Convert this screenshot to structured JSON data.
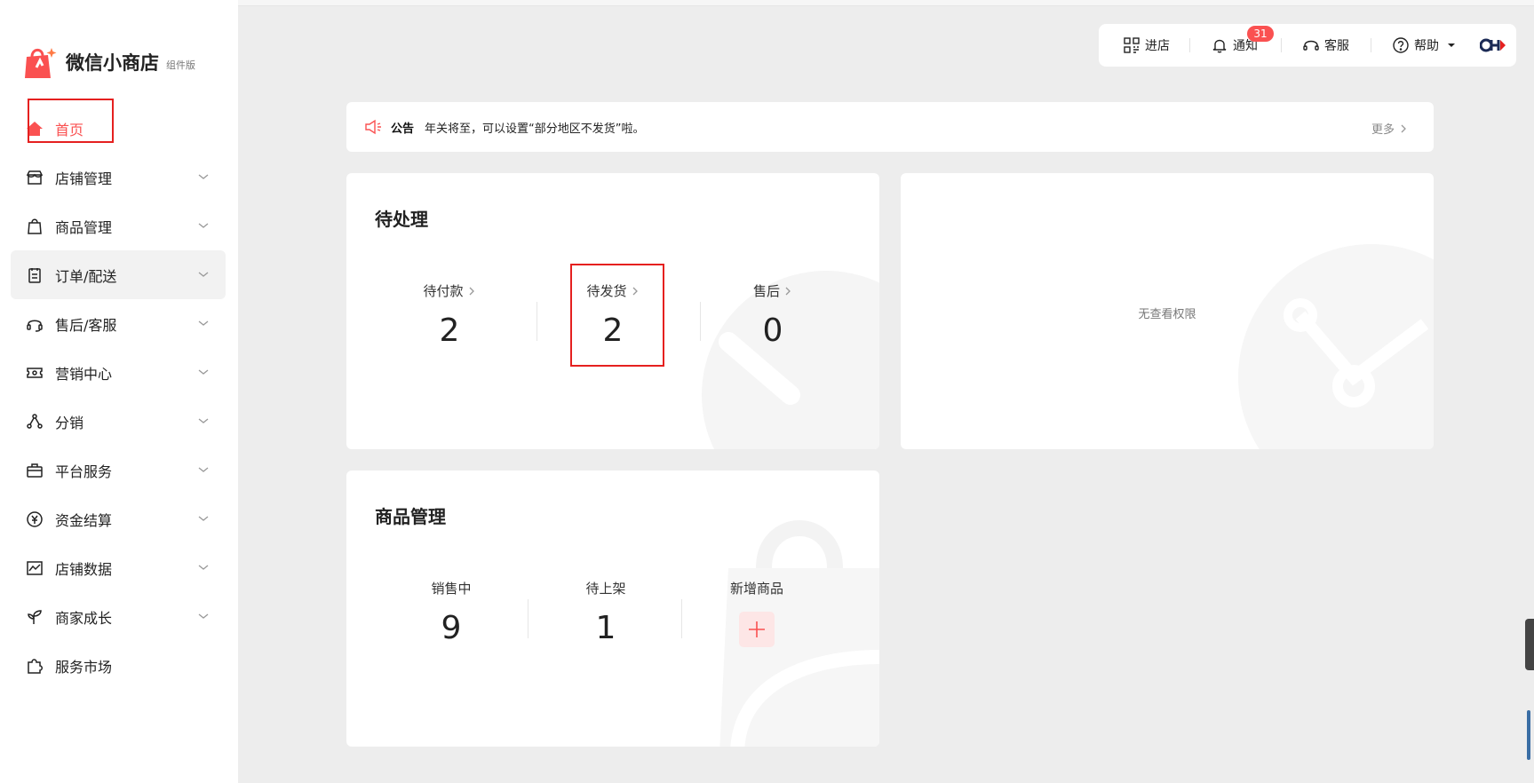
{
  "brand": {
    "name": "微信小商店",
    "tag": "组件版"
  },
  "sidebar": {
    "items": [
      {
        "label": "首页",
        "icon": "home-icon",
        "active": true
      },
      {
        "label": "店铺管理",
        "icon": "store-icon"
      },
      {
        "label": "商品管理",
        "icon": "shopping-bag-icon"
      },
      {
        "label": "订单/配送",
        "icon": "clipboard-icon"
      },
      {
        "label": "售后/客服",
        "icon": "headset-icon"
      },
      {
        "label": "营销中心",
        "icon": "ticket-icon"
      },
      {
        "label": "分销",
        "icon": "share-nodes-icon"
      },
      {
        "label": "平台服务",
        "icon": "briefcase-icon"
      },
      {
        "label": "资金结算",
        "icon": "yen-icon"
      },
      {
        "label": "店铺数据",
        "icon": "chart-icon"
      },
      {
        "label": "商家成长",
        "icon": "sprout-icon"
      },
      {
        "label": "服务市场",
        "icon": "puzzle-icon"
      }
    ]
  },
  "toolbar": {
    "enter_store": "进店",
    "notify": "通知",
    "notify_count": "31",
    "service": "客服",
    "help": "帮助"
  },
  "notice": {
    "title": "公告",
    "text": "年关将至，可以设置“部分地区不发货”啦。",
    "more": "更多"
  },
  "pending": {
    "title": "待处理",
    "items": [
      {
        "label": "待付款",
        "value": "2"
      },
      {
        "label": "待发货",
        "value": "2"
      },
      {
        "label": "售后",
        "value": "0"
      }
    ]
  },
  "right_card": {
    "text": "无查看权限"
  },
  "goods": {
    "title": "商品管理",
    "items": [
      {
        "label": "销售中",
        "value": "9"
      },
      {
        "label": "待上架",
        "value": "1"
      },
      {
        "label": "新增商品"
      }
    ]
  },
  "colors": {
    "accent": "#fa5151",
    "highlight_box": "#e5201f"
  }
}
